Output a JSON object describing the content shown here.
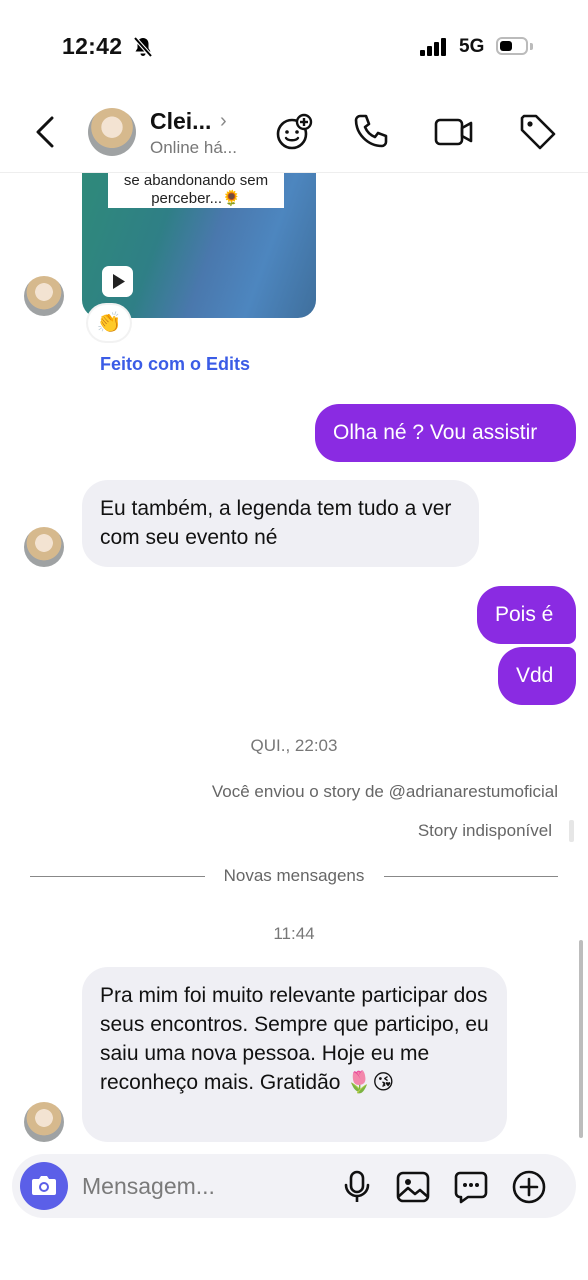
{
  "status_bar": {
    "time": "12:42",
    "network": "5G"
  },
  "header": {
    "contact_name": "Clei...",
    "contact_status": "Online há..."
  },
  "conversation": {
    "media_caption": "se abandonando sem perceber...🌻",
    "reaction_emoji": "👏",
    "edits_link": "Feito com o Edits",
    "msg_out_1": "Olha né ? Vou assistir",
    "msg_in_1": "Eu também, a legenda tem tudo a ver com seu evento né",
    "msg_out_2": "Pois é",
    "msg_out_3": "Vdd",
    "timestamp_1": "QUI., 22:03",
    "story_sent": "Você enviou o story de @adrianarestumoficial",
    "story_unavailable": "Story indisponível",
    "new_messages_label": "Novas mensagens",
    "timestamp_2": "11:44",
    "msg_in_2": "Pra mim foi muito relevante participar dos seus encontros. Sempre que participo, eu saiu uma nova pessoa. Hoje eu me reconheço mais. Gratidão 🌷😘"
  },
  "composer": {
    "placeholder": "Mensagem..."
  },
  "colors": {
    "outgoing_bubble": "#8a2be2",
    "incoming_bubble": "#efeff4",
    "link": "#3b5ce6",
    "camera_button": "#5b5fe8"
  }
}
